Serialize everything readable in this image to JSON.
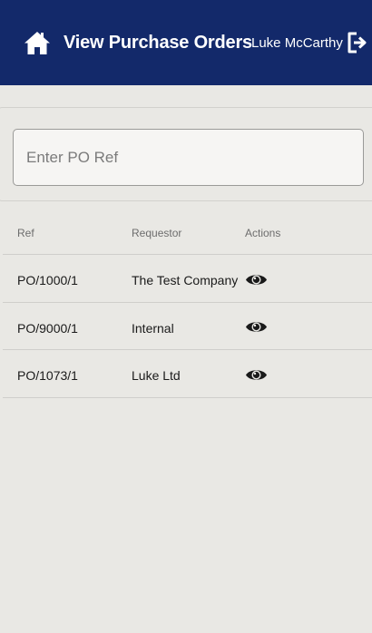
{
  "header": {
    "home_icon": "home-icon",
    "title": "View Purchase Orders",
    "user_name": "Luke McCarthy",
    "logout_icon": "logout-icon"
  },
  "search": {
    "placeholder": "Enter PO Ref",
    "value": ""
  },
  "table": {
    "columns": [
      "Ref",
      "Requestor",
      "Actions"
    ],
    "rows": [
      {
        "ref": "PO/1000/1",
        "requestor": "The Test Company",
        "action_icon": "eye-icon"
      },
      {
        "ref": "PO/9000/1",
        "requestor": "Internal",
        "action_icon": "eye-icon"
      },
      {
        "ref": "PO/1073/1",
        "requestor": "Luke Ltd",
        "action_icon": "eye-icon"
      }
    ]
  },
  "colors": {
    "header_bg": "#13296a",
    "page_bg": "#e9e8e4",
    "header_text": "#ffffff"
  }
}
